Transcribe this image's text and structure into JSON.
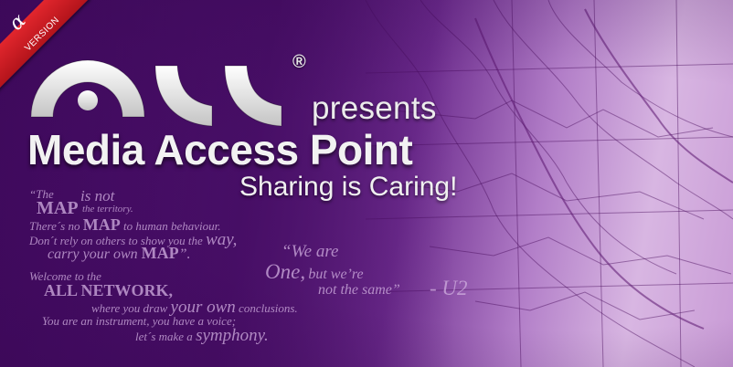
{
  "ribbon": {
    "symbol": "α",
    "label": "VERSION",
    "color": "#d41f26"
  },
  "logo": {
    "registered_mark": "®"
  },
  "headline": {
    "presents": "presents",
    "title": "Media Access Point",
    "tagline": "Sharing is Caring!"
  },
  "quote1": {
    "l1a": "“The",
    "l1b": "MAP",
    "l1c": "is not",
    "l1d": "the territory.",
    "l2a": "There´s no",
    "l2b": "MAP",
    "l2c": "to human behaviour.",
    "l3a": "Don´t rely on others to show you the",
    "l3b": "way,",
    "l4a": "carry your own",
    "l4b": "MAP",
    "l4c": "”."
  },
  "quote2": {
    "l1": "Welcome to the",
    "l2": "ALL NETWORK,",
    "l3a": "where you draw",
    "l3b": "your own",
    "l3c": "conclusions.",
    "l4": "You are an instrument, you have a voice;",
    "l5a": "let´s make a",
    "l5b": "symphony."
  },
  "quote3": {
    "l1": "“We are",
    "l2a": "One,",
    "l2b": "but we’re",
    "l3": "not the same”",
    "attribution": "- U2"
  },
  "colors": {
    "background": "#4a0f6a",
    "map_tint": "#d8b6e2",
    "text_main": "#f2f2f2"
  }
}
